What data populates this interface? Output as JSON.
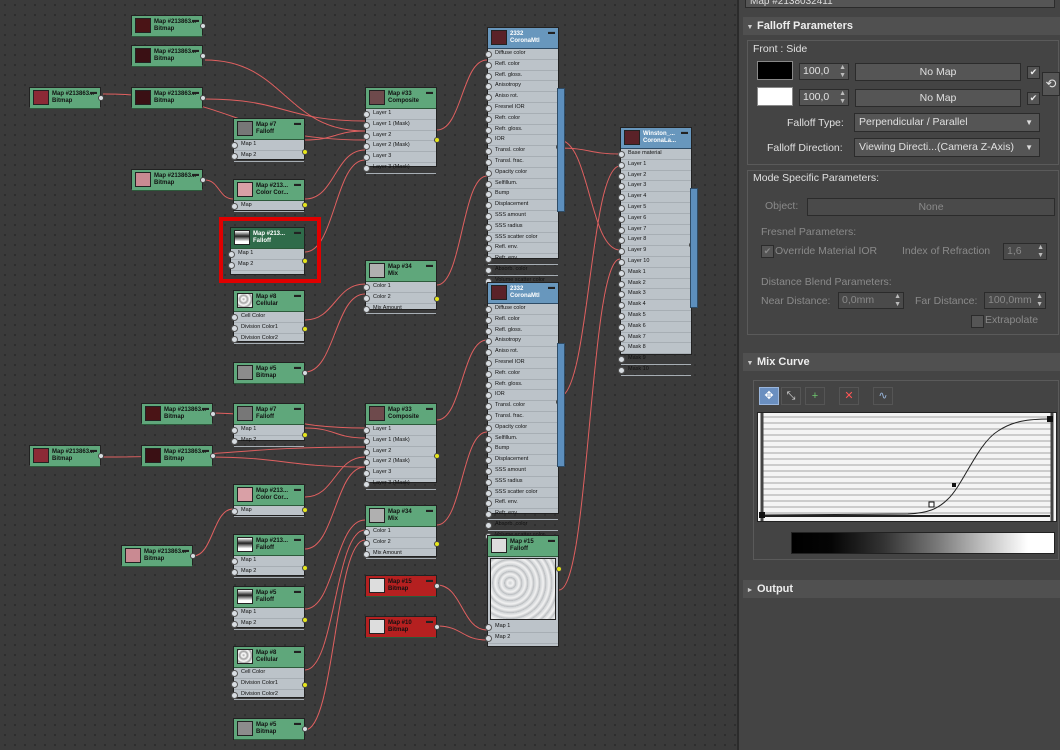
{
  "editor": {
    "colors": {
      "bitmap_header": "#5fa77b",
      "material_header": "#6897bd",
      "highlight": "#e00000",
      "wire": "#e06060",
      "wire_blue": "#4f86c0"
    },
    "nodes": [
      {
        "id": "n1",
        "t1": "Map #213863...",
        "t2": "Bitmap",
        "thumb": "#4a1416",
        "slots": []
      },
      {
        "id": "n2",
        "t1": "Map #213863...",
        "t2": "Bitmap",
        "thumb": "#3a1014",
        "slots": []
      },
      {
        "id": "n3",
        "t1": "Map #213863...",
        "t2": "Bitmap",
        "thumb": "#8c2a36",
        "slots": []
      },
      {
        "id": "n4",
        "t1": "Map #213863...",
        "t2": "Bitmap",
        "thumb": "#3a1014",
        "slots": []
      },
      {
        "id": "n5",
        "t1": "Map #213863...",
        "t2": "Bitmap",
        "thumb": "#c98a92",
        "slots": []
      },
      {
        "id": "n6",
        "t1": "Map #7",
        "t2": "Falloff",
        "thumb": "#777",
        "slots": [
          "Map 1",
          "Map 2"
        ]
      },
      {
        "id": "n7",
        "t1": "Map #213...",
        "t2": "Color Cor...",
        "thumb": "#d9a0a6",
        "slots": [
          "Map"
        ]
      },
      {
        "id": "n8",
        "t1": "Map #213...",
        "t2": "Falloff",
        "thumb": "#333",
        "slots": [
          "Map 1",
          "Map 2"
        ]
      },
      {
        "id": "n9",
        "t1": "Map #8",
        "t2": "Cellular",
        "thumb": "#e0e0e0",
        "slots": [
          "Cell Color",
          "Division Color1",
          "Division Color2"
        ]
      },
      {
        "id": "n10",
        "t1": "Map #5",
        "t2": "Bitmap",
        "thumb": "#8c8c8c",
        "slots": []
      },
      {
        "id": "n11",
        "t1": "Map #33",
        "t2": "Composite",
        "thumb": "#6e4a4c",
        "slots": [
          "Layer 1",
          "Layer 1 (Mask)",
          "Layer 2",
          "Layer 2 (Mask)",
          "Layer 3",
          "Layer 3 (Mask)"
        ]
      },
      {
        "id": "n12",
        "t1": "Map #34",
        "t2": "Mix",
        "thumb": "#b0b0b0",
        "slots": [
          "Color 1",
          "Color 2",
          "Mix Amount"
        ]
      },
      {
        "id": "n13",
        "t1": "2332",
        "t2": "CoronaMtl",
        "thumb": "#5a2228",
        "slots": [
          "Diffuse color",
          "Refl. color",
          "Refl. gloss.",
          "Anisotropy",
          "Aniso rot.",
          "Fresnel IOR",
          "Refr. color",
          "Refr. gloss.",
          "IOR",
          "Transl. color",
          "Transl. frac.",
          "Opacity color",
          "Selfillum.",
          "Bump",
          "Displacement",
          "SSS amount",
          "SSS radius",
          "SSS scatter color",
          "Refl. env.",
          "Refr. env.",
          "Absorb. color",
          "Volume scatter color"
        ]
      },
      {
        "id": "n14",
        "t1": "2332",
        "t2": "CoronaMtl",
        "thumb": "#5a2228",
        "slots": [
          "Diffuse color",
          "Refl. color",
          "Refl. gloss.",
          "Anisotropy",
          "Aniso rot.",
          "Fresnel IOR",
          "Refr. color",
          "Refr. gloss.",
          "IOR",
          "Transl. color",
          "Transl. frac.",
          "Opacity color",
          "Selfillum.",
          "Bump",
          "Displacement",
          "SSS amount",
          "SSS radius",
          "SSS scatter color",
          "Refl. env.",
          "Refr. env.",
          "Absorb. color",
          "Volume scatter color"
        ]
      },
      {
        "id": "n15",
        "t1": "Winston_...",
        "t2": "CoronaLa...",
        "thumb": "#5a2228",
        "slots": [
          "Base material",
          "Layer 1",
          "Layer 2",
          "Layer 3",
          "Layer 4",
          "Layer 5",
          "Layer 6",
          "Layer 7",
          "Layer 8",
          "Layer 9",
          "Layer 10",
          "Mask 1",
          "Mask 2",
          "Mask 3",
          "Mask 4",
          "Mask 5",
          "Mask 6",
          "Mask 7",
          "Mask 8",
          "Mask 9",
          "Mask 10"
        ]
      },
      {
        "id": "n16",
        "t1": "Map #213863...",
        "t2": "Bitmap",
        "thumb": "#4a1416",
        "slots": []
      },
      {
        "id": "n17",
        "t1": "Map #7",
        "t2": "Falloff",
        "thumb": "#777",
        "slots": [
          "Map 1",
          "Map 2"
        ]
      },
      {
        "id": "n18",
        "t1": "Map #213863...",
        "t2": "Bitmap",
        "thumb": "#8c2a36",
        "slots": []
      },
      {
        "id": "n19",
        "t1": "Map #213863...",
        "t2": "Bitmap",
        "thumb": "#3a1014",
        "slots": []
      },
      {
        "id": "n20",
        "t1": "Map #33",
        "t2": "Composite",
        "thumb": "#6e4a4c",
        "slots": [
          "Layer 1",
          "Layer 1 (Mask)",
          "Layer 2",
          "Layer 2 (Mask)",
          "Layer 3",
          "Layer 3 (Mask)"
        ]
      },
      {
        "id": "n21",
        "t1": "Map #213...",
        "t2": "Color Cor...",
        "thumb": "#d9a0a6",
        "slots": [
          "Map"
        ]
      },
      {
        "id": "n22",
        "t1": "Map #213863...",
        "t2": "Bitmap",
        "thumb": "#c98a92",
        "slots": []
      },
      {
        "id": "n23",
        "t1": "Map #213...",
        "t2": "Falloff",
        "thumb": "#333",
        "slots": [
          "Map 1",
          "Map 2"
        ]
      },
      {
        "id": "n24",
        "t1": "Map #34",
        "t2": "Mix",
        "thumb": "#b0b0b0",
        "slots": [
          "Color 1",
          "Color 2",
          "Mix Amount"
        ]
      },
      {
        "id": "n25",
        "t1": "Map #5",
        "t2": "Falloff",
        "thumb": "#333",
        "slots": [
          "Map 1",
          "Map 2"
        ]
      },
      {
        "id": "n26",
        "t1": "Map #15",
        "t2": "Falloff",
        "thumb": "#ddd",
        "slots": [
          "Map 1",
          "Map 2"
        ]
      },
      {
        "id": "n27",
        "t1": "Map #15",
        "t2": "Bitmap",
        "thumb": "#ddd",
        "slots": []
      },
      {
        "id": "n28",
        "t1": "Map #10",
        "t2": "Bitmap",
        "thumb": "#ddd",
        "slots": []
      },
      {
        "id": "n29",
        "t1": "Map #8",
        "t2": "Cellular",
        "thumb": "#e0e0e0",
        "slots": [
          "Cell Color",
          "Division Color1",
          "Division Color2"
        ]
      },
      {
        "id": "n30",
        "t1": "Map #5",
        "t2": "Bitmap",
        "thumb": "#8c8c8c",
        "slots": []
      }
    ]
  },
  "panel": {
    "top_field": "Map #2138032411",
    "falloff_title": "Falloff Parameters",
    "front_side": "Front : Side",
    "front": {
      "color": "#000000",
      "value": "100,0",
      "map": "No Map",
      "checked": "✔"
    },
    "side": {
      "color": "#ffffff",
      "value": "100,0",
      "map": "No Map",
      "checked": "✔"
    },
    "swap_icon": "⟲",
    "falloff_type_label": "Falloff Type:",
    "falloff_type_value": "Perpendicular / Parallel",
    "falloff_dir_label": "Falloff Direction:",
    "falloff_dir_value": "Viewing Directi...(Camera Z-Axis)",
    "mode_title": "Mode Specific Parameters:",
    "object_label": "Object:",
    "object_value": "None",
    "fresnel_title": "Fresnel Parameters:",
    "override_label": "Override Material IOR",
    "override_check": "✔",
    "ior_label": "Index of Refraction",
    "ior_value": "1,6",
    "distance_title": "Distance Blend Parameters:",
    "near_label": "Near Distance:",
    "near_value": "0,0mm",
    "far_label": "Far Distance:",
    "far_value": "100,0mm",
    "extrapolate_label": "Extrapolate",
    "mix_curve_title": "Mix Curve",
    "curve_y_top": "1",
    "curve_y_bottom": "0",
    "toolbar": {
      "move": "✥",
      "scale": "⤡",
      "add": "+",
      "delete": "✕",
      "smooth": "∿"
    },
    "output_title": "Output"
  }
}
